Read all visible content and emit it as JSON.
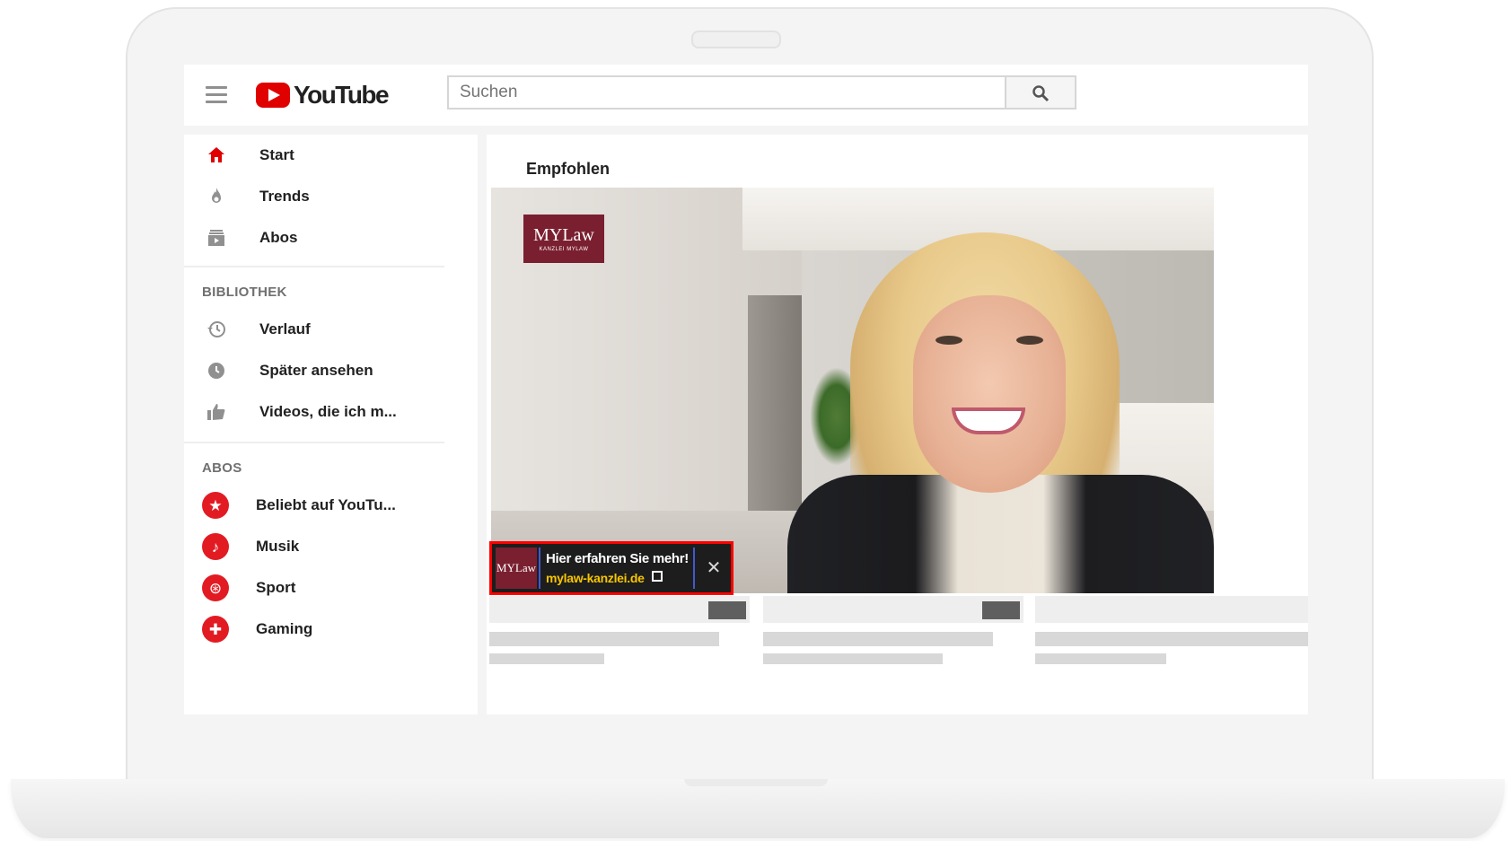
{
  "header": {
    "logo_text": "YouTube",
    "search_placeholder": "Suchen"
  },
  "sidebar": {
    "main_items": [
      {
        "label": "Start",
        "icon": "home-icon"
      },
      {
        "label": "Trends",
        "icon": "flame-icon"
      },
      {
        "label": "Abos",
        "icon": "subscriptions-icon"
      }
    ],
    "library_title": "BIBLIOTHEK",
    "library_items": [
      {
        "label": "Verlauf",
        "icon": "history-icon"
      },
      {
        "label": "Später ansehen",
        "icon": "clock-icon"
      },
      {
        "label": "Videos, die ich m...",
        "icon": "thumbs-up-icon"
      }
    ],
    "abos_title": "ABOS",
    "abo_items": [
      {
        "label": "Beliebt auf YouTu...",
        "icon": "star-icon"
      },
      {
        "label": "Musik",
        "icon": "music-icon"
      },
      {
        "label": "Sport",
        "icon": "sport-icon"
      },
      {
        "label": "Gaming",
        "icon": "gamepad-icon"
      }
    ]
  },
  "main": {
    "section_heading": "Empfohlen"
  },
  "video": {
    "watermark_line1": "MYLaw",
    "watermark_line2": "KANZLEI MYLAW"
  },
  "ad": {
    "thumb_text": "MYLaw",
    "title": "Hier erfahren Sie mehr!",
    "url": "mylaw-kanzlei.de",
    "close_glyph": "✕"
  },
  "colors": {
    "brand_red": "#e00000",
    "ad_highlight": "#ff0000",
    "ad_url": "#f7c500",
    "law_brand": "#7a1f30"
  }
}
